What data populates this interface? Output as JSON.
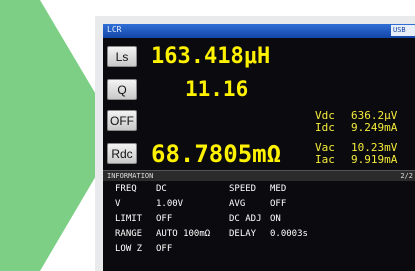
{
  "colors": {
    "arrow": "#7ccf84",
    "value": "#fff200",
    "titlebar": "#1d57c2"
  },
  "titlebar": {
    "mode": "LCR",
    "usb": "USB"
  },
  "buttons": {
    "ls": "Ls",
    "q": "Q",
    "off": "OFF",
    "rdc": "Rdc"
  },
  "main": {
    "ls_value": "163.418μH",
    "q_value": "11.16",
    "rdc_value": "68.7805mΩ"
  },
  "side": {
    "vdc_label": "Vdc",
    "vdc_value": "636.2μV",
    "idc_label": "Idc",
    "idc_value": "9.249mA",
    "vac_label": "Vac",
    "vac_value": "10.23mV",
    "iac_label": "Iac",
    "iac_value": "9.919mA"
  },
  "info": {
    "header": "INFORMATION",
    "page": "2/2",
    "freq_label": "FREQ",
    "freq_value": "DC",
    "v_label": "V",
    "v_value": "1.00V",
    "limit_label": "LIMIT",
    "limit_value": "OFF",
    "range_label": "RANGE",
    "range_value": "AUTO 100mΩ",
    "lowz_label": "LOW Z",
    "lowz_value": "OFF",
    "speed_label": "SPEED",
    "speed_value": "MED",
    "avg_label": "AVG",
    "avg_value": "OFF",
    "dcadj_label": "DC ADJ",
    "dcadj_value": "ON",
    "delay_label": "DELAY",
    "delay_value": "0.0003s"
  }
}
